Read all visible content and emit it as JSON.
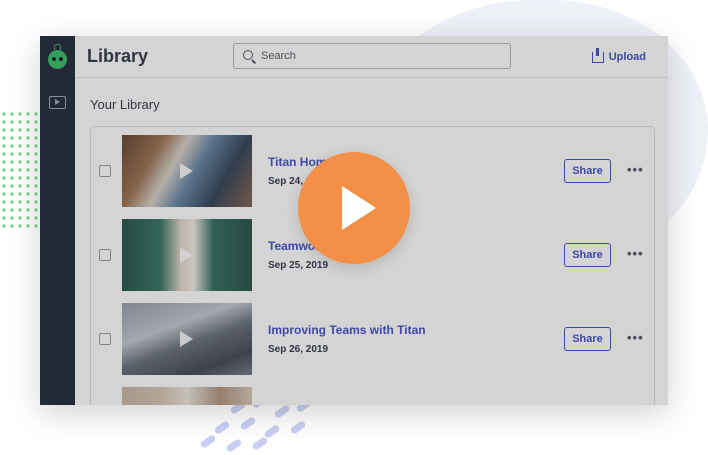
{
  "header": {
    "app_title": "Library",
    "search_placeholder": "Search",
    "upload_label": "Upload"
  },
  "library": {
    "section_title": "Your Library",
    "items": [
      {
        "title": "Titan Home",
        "date": "Sep 24, 2019",
        "share_label": "Share",
        "more_label": "•••"
      },
      {
        "title": "Teamwork eam Work",
        "date": "Sep 25, 2019",
        "share_label": "Share",
        "more_label": "•••"
      },
      {
        "title": "Improving Teams with Titan",
        "date": "Sep 26, 2019",
        "share_label": "Share",
        "more_label": "•••"
      },
      {
        "title": "",
        "date": "",
        "share_label": "",
        "more_label": ""
      }
    ]
  },
  "colors": {
    "accent": "#4c56c8",
    "sidebar": "#2c3243",
    "play_button": "#f48f48",
    "logo": "#3fbf6e"
  },
  "icons": [
    "logo-icon",
    "video-library-icon",
    "search-icon",
    "upload-icon",
    "play-icon",
    "more-icon"
  ]
}
